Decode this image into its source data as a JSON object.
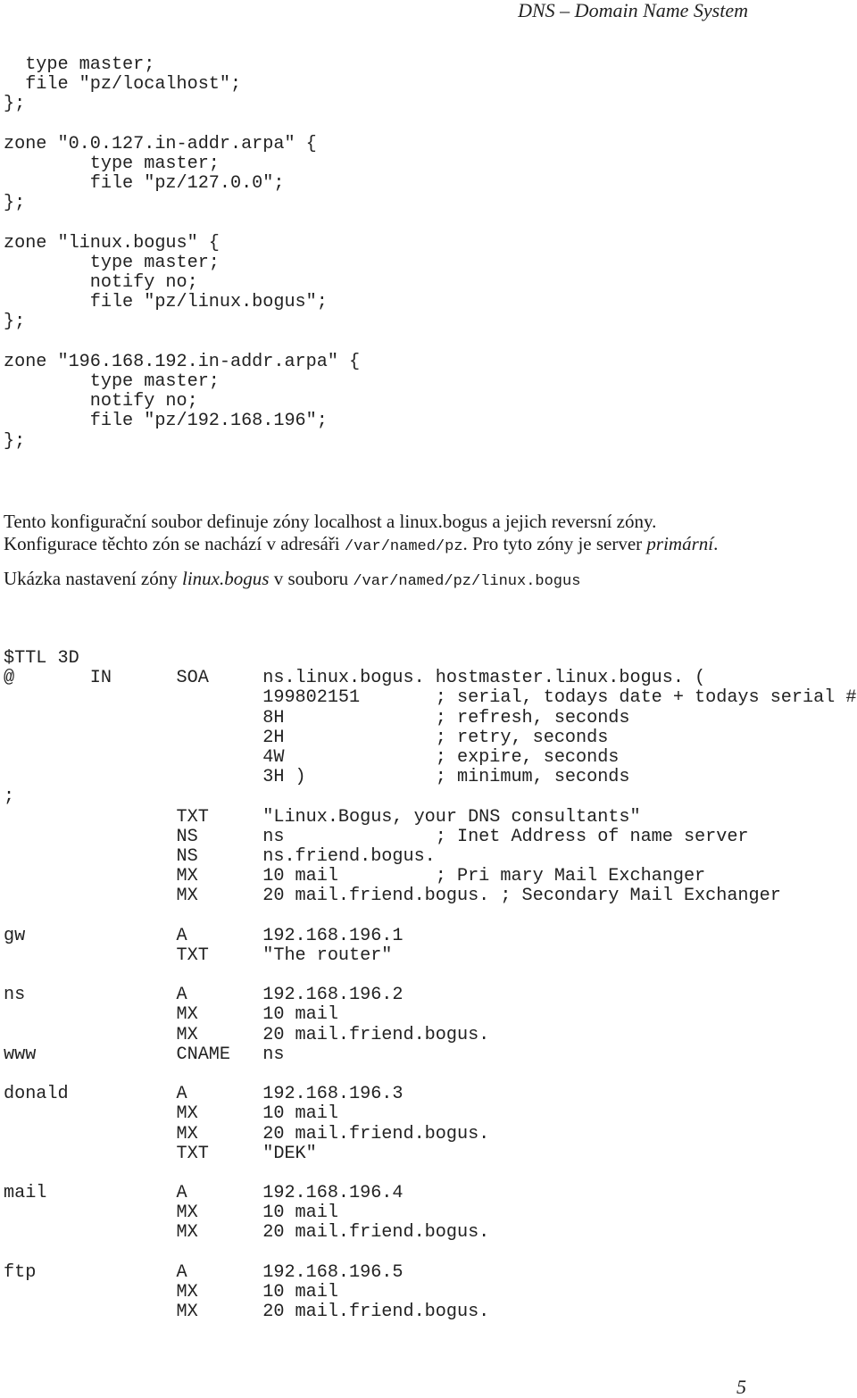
{
  "header": {
    "title": "DNS – Domain Name System"
  },
  "named_conf_lines": [
    "  type master;",
    "  file \"pz/localhost\";",
    "};",
    "",
    "zone \"0.0.127.in-addr.arpa\" {",
    "        type master;",
    "        file \"pz/127.0.0\";",
    "};",
    "",
    "zone \"linux.bogus\" {",
    "        type master;",
    "        notify no;",
    "        file \"pz/linux.bogus\";",
    "};",
    "",
    "zone \"196.168.192.in-addr.arpa\" {",
    "        type master;",
    "        notify no;",
    "        file \"pz/192.168.196\";",
    "};"
  ],
  "paragraph1": {
    "part1": "Tento konfigurační soubor definuje zóny localhost a linux.bogus a jejich reversní zóny. Konfigurace těchto zón se nachází v adresáři ",
    "path": "/var/named/pz",
    "part2": ". Pro tyto zóny je server ",
    "emphasis": "primární",
    "part3": "."
  },
  "paragraph2": {
    "part1": "Ukázka nastavení zóny ",
    "emphasis": "linux.bogus",
    "part2": " v souboru ",
    "path": "/var/named/pz/linux.bogus"
  },
  "zone_file_lines": [
    "$TTL 3D",
    "@       IN      SOA     ns.linux.bogus. hostmaster.linux.bogus. (",
    "                        199802151       ; serial, todays date + todays serial #",
    "                        8H              ; refresh, seconds",
    "                        2H              ; retry, seconds",
    "                        4W              ; expire, seconds",
    "                        3H )            ; minimum, seconds",
    ";",
    "                TXT     \"Linux.Bogus, your DNS consultants\"",
    "                NS      ns              ; Inet Address of name server",
    "                NS      ns.friend.bogus.",
    "                MX      10 mail         ; Pri mary Mail Exchanger",
    "                MX      20 mail.friend.bogus. ; Secondary Mail Exchanger",
    "",
    "gw              A       192.168.196.1",
    "                TXT     \"The router\"",
    "",
    "ns              A       192.168.196.2",
    "                MX      10 mail",
    "                MX      20 mail.friend.bogus.",
    "www             CNAME   ns",
    "",
    "donald          A       192.168.196.3",
    "                MX      10 mail",
    "                MX      20 mail.friend.bogus.",
    "                TXT     \"DEK\"",
    "",
    "mail            A       192.168.196.4",
    "                MX      10 mail",
    "                MX      20 mail.friend.bogus.",
    "",
    "ftp             A       192.168.196.5",
    "                MX      10 mail",
    "                MX      20 mail.friend.bogus."
  ],
  "page_number": "5"
}
